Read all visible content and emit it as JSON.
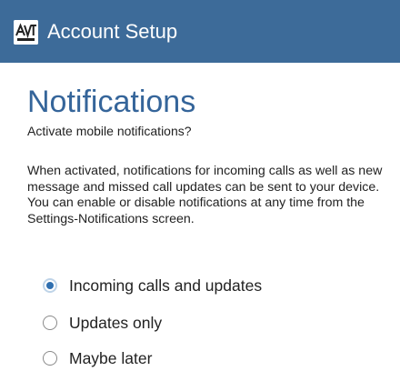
{
  "app_bar": {
    "title": "Account Setup",
    "logo_icon": "avt-logo-icon",
    "background": "#3d6b99"
  },
  "page": {
    "heading": "Notifications",
    "subtitle": "Activate mobile notifications?",
    "description": "When activated, notifications for incoming calls as well as new message and missed call updates can be sent to your device. You can enable or disable notifications at any time from the Settings-Notifications screen.",
    "accent_color": "#35659a"
  },
  "options": [
    {
      "label": "Incoming calls and updates",
      "selected": true
    },
    {
      "label": "Updates only",
      "selected": false
    },
    {
      "label": "Maybe later",
      "selected": false
    }
  ]
}
